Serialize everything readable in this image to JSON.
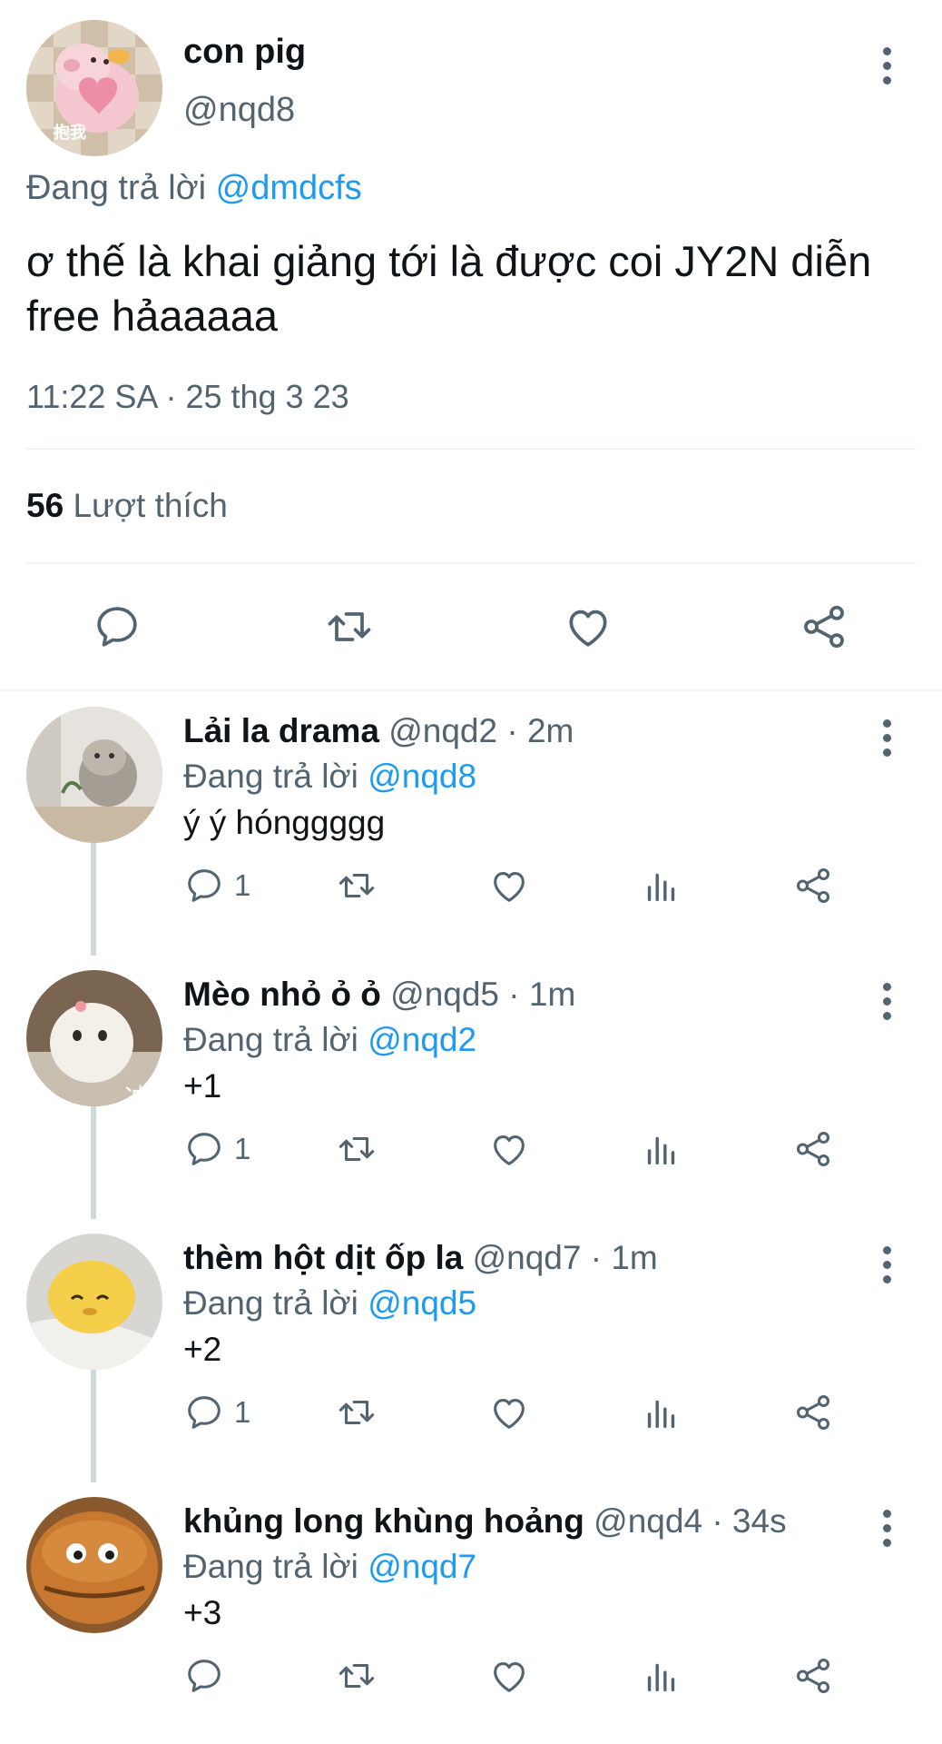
{
  "main_tweet": {
    "display_name": "con pig",
    "handle": "@nqd8",
    "avatar_caption": "抱我",
    "replying_label": "Đang trả lời",
    "replying_handle": "@dmdcfs",
    "text": "ơ thế là khai giảng tới là được coi JY2N diễn free hảaaaaa",
    "timestamp": "11:22 SA · 25 thg 3 23",
    "likes_count": "56",
    "likes_label": "Lượt thích"
  },
  "replies": [
    {
      "display_name": "Lải la drama",
      "handle": "@nqd2",
      "time": "· 2m",
      "replying_label": "Đang trả lời",
      "replying_handle": "@nqd8",
      "text": "ý ý hónggggg",
      "reply_count": "1"
    },
    {
      "display_name": "Mèo nhỏ ỏ ỏ",
      "handle": "@nqd5",
      "time": "· 1m",
      "replying_label": "Đang trả lời",
      "replying_handle": "@nqd2",
      "text": "+1",
      "reply_count": "1"
    },
    {
      "display_name": "thèm hột dịt ốp la",
      "handle": "@nqd7",
      "time": "· 1m",
      "replying_label": "Đang trả lời",
      "replying_handle": "@nqd5",
      "text": "+2",
      "reply_count": "1"
    },
    {
      "display_name": "khủng long khùng hoảng",
      "handle": "@nqd4",
      "time": "· 34s",
      "replying_label": "Đang trả lời",
      "replying_handle": "@nqd7",
      "text": "+3",
      "reply_count": ""
    }
  ],
  "colors": {
    "link": "#1d9bf0",
    "muted": "#536471",
    "text": "#0f1419",
    "divider": "#eff3f4"
  },
  "icons": [
    "reply-icon",
    "retweet-icon",
    "like-icon",
    "views-icon",
    "share-icon",
    "more-icon"
  ]
}
